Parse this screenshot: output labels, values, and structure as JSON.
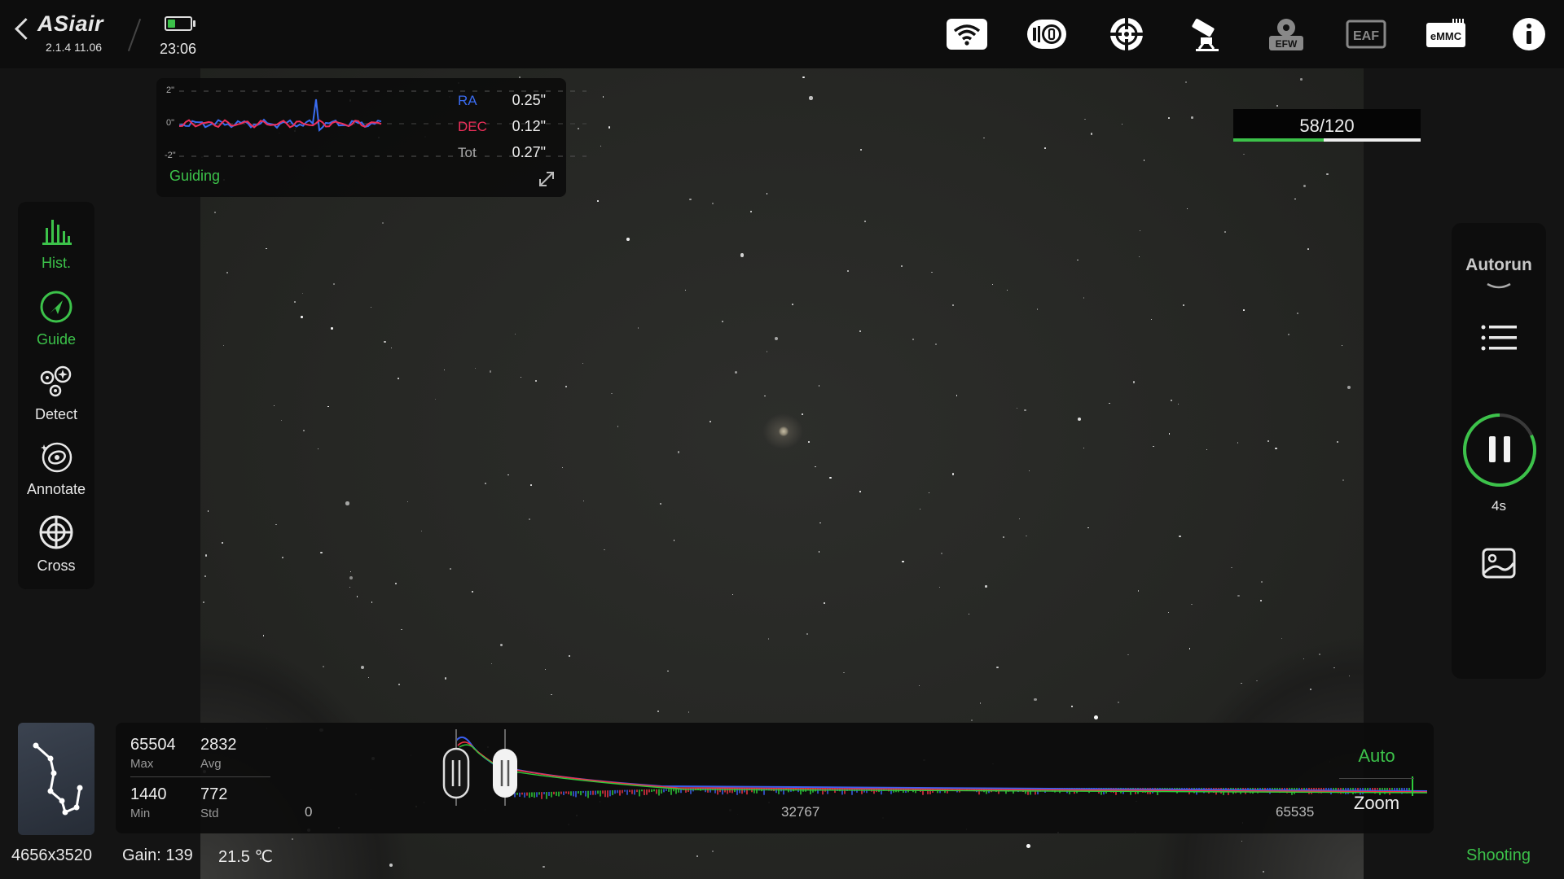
{
  "app": {
    "logo": "ASiair",
    "version": "2.1.4 11.06",
    "time": "23:06",
    "battery_level": 0.35
  },
  "topbar": {
    "icons": [
      "wifi-icon",
      "camera-power-icon",
      "mount-target-icon",
      "telescope-icon",
      "efw-icon",
      "eaf-icon",
      "emmc-icon",
      "info-icon"
    ],
    "efw_label": "EFW",
    "eaf_label": "EAF",
    "emmc_label": "eMMC"
  },
  "guide": {
    "ticks": [
      "2\"",
      "0\"",
      "-2\""
    ],
    "ra_label": "RA",
    "ra_value": "0.25\"",
    "dec_label": "DEC",
    "dec_value": "0.12\"",
    "tot_label": "Tot",
    "tot_value": "0.27\"",
    "status": "Guiding",
    "colors": {
      "ra": "#3a6cf0",
      "dec": "#ee2f5a",
      "status": "#3cc24a"
    }
  },
  "tools": [
    {
      "label": "Hist.",
      "icon": "histogram-icon",
      "active": true
    },
    {
      "label": "Guide",
      "icon": "guide-icon",
      "active": true
    },
    {
      "label": "Detect",
      "icon": "detect-stars-icon",
      "active": false
    },
    {
      "label": "Annotate",
      "icon": "annotate-galaxy-icon",
      "active": false
    },
    {
      "label": "Cross",
      "icon": "crosshair-icon",
      "active": false
    }
  ],
  "progress": {
    "text": "58/120",
    "fraction": 0.483
  },
  "right": {
    "autorun": "Autorun",
    "exposure": "4s",
    "icons": [
      "list-icon",
      "pause-icon",
      "image-icon"
    ]
  },
  "histogram": {
    "max_value": "65504",
    "max_label": "Max",
    "avg_value": "2832",
    "avg_label": "Avg",
    "min_value": "1440",
    "min_label": "Min",
    "std_value": "772",
    "std_label": "Std",
    "axis": [
      "0",
      "32767",
      "65535"
    ],
    "auto_label": "Auto",
    "zoom_label": "Zoom"
  },
  "status": {
    "resolution": "4656x3520",
    "gain": "Gain: 139",
    "temperature": "21.5 ℃",
    "mode": "Shooting"
  },
  "accent": "#3cc24a"
}
